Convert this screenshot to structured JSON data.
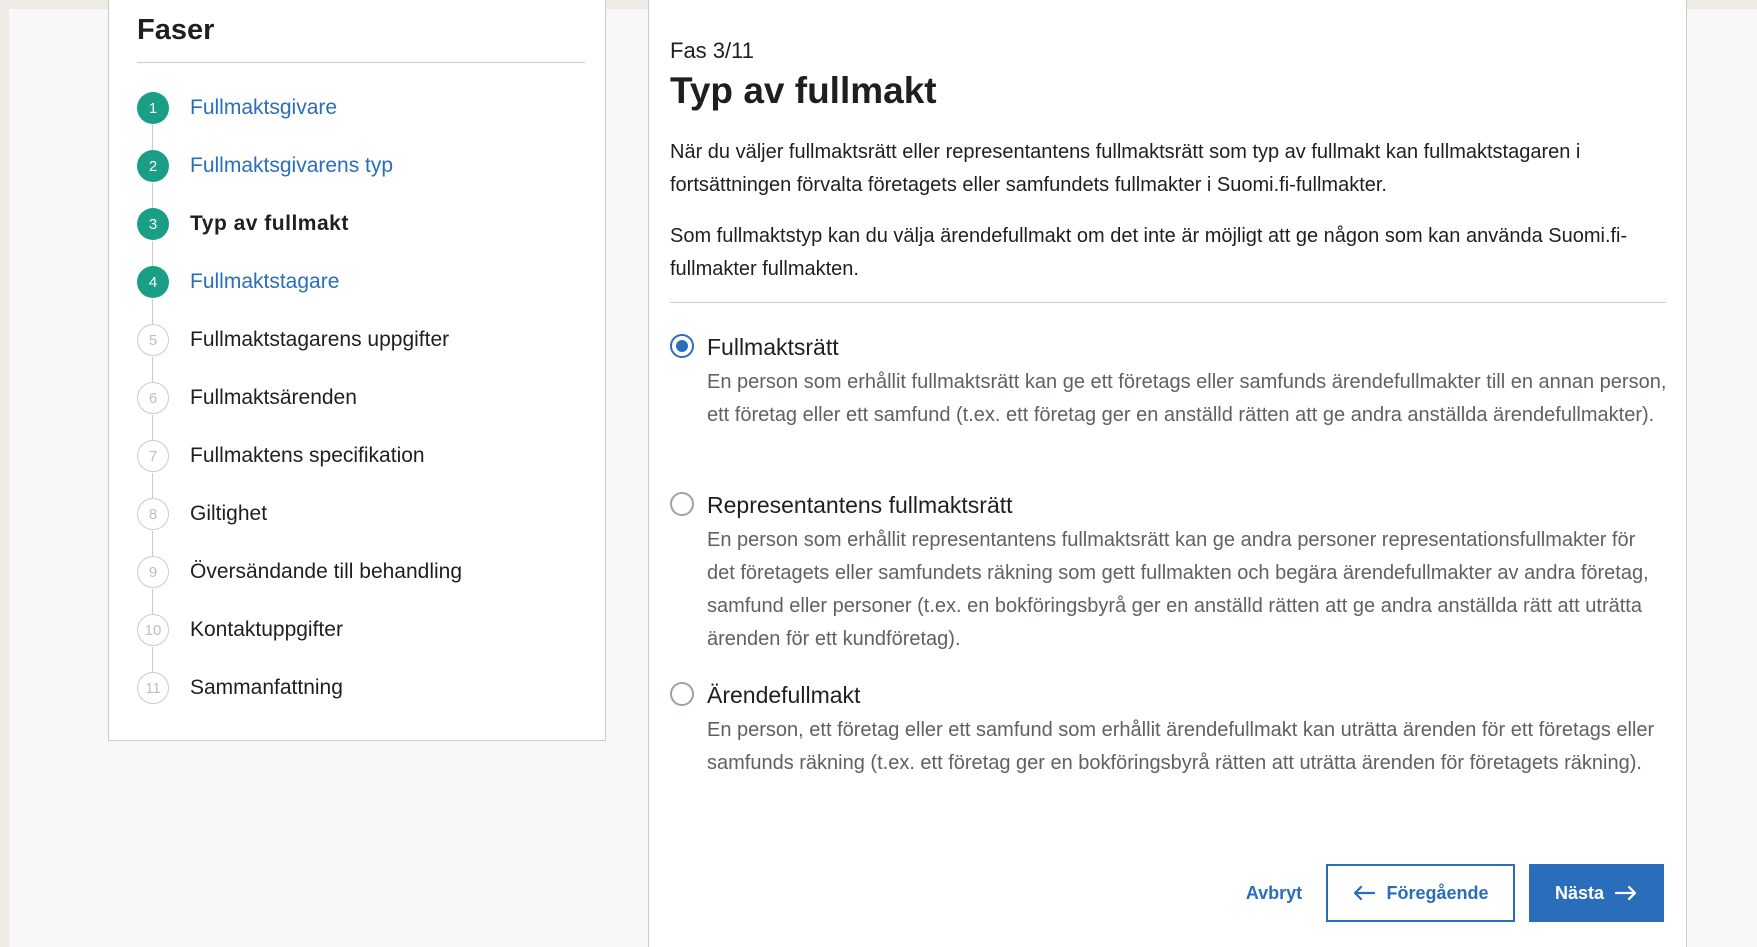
{
  "sidebar": {
    "title": "Faser",
    "steps": [
      {
        "num": "1",
        "label": "Fullmaktsgivare",
        "state": "done"
      },
      {
        "num": "2",
        "label": "Fullmaktsgivarens typ",
        "state": "done"
      },
      {
        "num": "3",
        "label": "Typ av fullmakt",
        "state": "current"
      },
      {
        "num": "4",
        "label": "Fullmaktstagare",
        "state": "done"
      },
      {
        "num": "5",
        "label": "Fullmaktstagarens uppgifter",
        "state": "todo"
      },
      {
        "num": "6",
        "label": "Fullmaktsärenden",
        "state": "todo"
      },
      {
        "num": "7",
        "label": "Fullmaktens specifikation",
        "state": "todo"
      },
      {
        "num": "8",
        "label": "Giltighet",
        "state": "todo"
      },
      {
        "num": "9",
        "label": "Översändande till behandling",
        "state": "todo"
      },
      {
        "num": "10",
        "label": "Kontaktuppgifter",
        "state": "todo"
      },
      {
        "num": "11",
        "label": "Sammanfattning",
        "state": "todo"
      }
    ]
  },
  "main": {
    "phase_count": "Fas 3/11",
    "title": "Typ av fullmakt",
    "intro_1": "När du väljer fullmaktsrätt eller representantens fullmaktsrätt som typ av fullmakt kan fullmaktstagaren i fortsättningen förvalta företagets eller samfundets fullmakter i Suomi.fi-fullmakter.",
    "intro_2": "Som fullmaktstyp kan du välja ärendefullmakt om det inte är möjligt att ge någon som kan använda Suomi.fi-fullmakter fullmakten.",
    "options": [
      {
        "title": "Fullmaktsrätt",
        "description": "En person som erhållit fullmaktsrätt kan ge ett företags eller samfunds ärendefullmakter till en annan person, ett företag eller ett samfund (t.ex. ett företag ger en anställd rätten att ge andra anställda ärendefullmakter).",
        "selected": true
      },
      {
        "title": "Representantens fullmaktsrätt",
        "description": "En person som erhållit representantens fullmaktsrätt kan ge andra personer representationsfullmakter för det företagets eller samfundets räkning som gett fullmakten och begära ärendefullmakter av andra företag, samfund eller personer (t.ex. en bokföringsbyrå ger en anställd rätten att ge andra anställda rätt att uträtta ärenden för ett kundföretag).",
        "selected": false
      },
      {
        "title": "Ärendefullmakt",
        "description": "En person, ett företag eller ett samfund som erhållit ärendefullmakt kan uträtta ärenden för ett företags eller samfunds räkning (t.ex. ett företag ger en bokföringsbyrå rätten att uträtta ärenden för företagets räkning).",
        "selected": false
      }
    ]
  },
  "buttons": {
    "cancel": "Avbryt",
    "previous": "Föregående",
    "next": "Nästa"
  },
  "colors": {
    "accent": "#2a6ebb",
    "step_done": "#1a9e85",
    "border": "#c8cdd0"
  }
}
